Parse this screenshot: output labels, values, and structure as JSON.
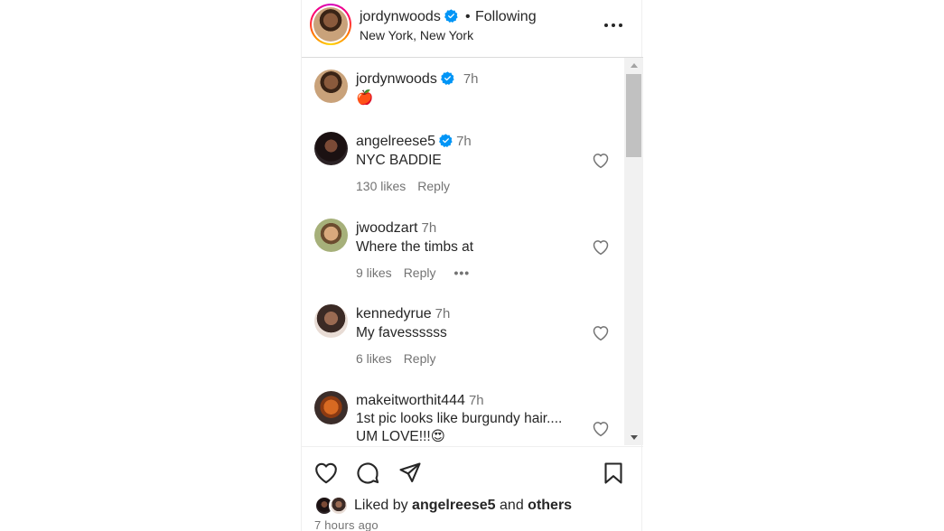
{
  "header": {
    "username": "jordynwoods",
    "separator": "•",
    "follow_status": "Following",
    "location": "New York, New York",
    "more_icon": "more-horizontal-icon"
  },
  "caption": {
    "username": "jordynwoods",
    "time": "7h",
    "text": "🍎"
  },
  "comments": [
    {
      "username": "angelreese5",
      "verified": true,
      "time": "7h",
      "text": "NYC BADDIE",
      "likes": "130 likes",
      "reply": "Reply"
    },
    {
      "username": "jwoodzart",
      "verified": false,
      "time": "7h",
      "text": "Where the timbs at",
      "likes": "9 likes",
      "reply": "Reply",
      "more": "•••"
    },
    {
      "username": "kennedyrue",
      "verified": false,
      "time": "7h",
      "text": "My favessssss",
      "likes": "6 likes",
      "reply": "Reply"
    },
    {
      "username": "makeitworthit444",
      "verified": false,
      "time": "7h",
      "text_line1": "1st pic looks like burgundy hair....",
      "text_line2": "UM LOVE!!!😍"
    }
  ],
  "actions": {
    "icons": [
      "heart-icon",
      "comment-icon",
      "share-icon",
      "bookmark-icon"
    ],
    "liked_prefix": "Liked by",
    "liked_user": "angelreese5",
    "liked_and": "and",
    "liked_others": "others",
    "timestamp": "7 hours ago"
  },
  "colors": {
    "verified_blue": "#0095f6",
    "secondary_text": "#737373",
    "primary_text": "#262626"
  }
}
